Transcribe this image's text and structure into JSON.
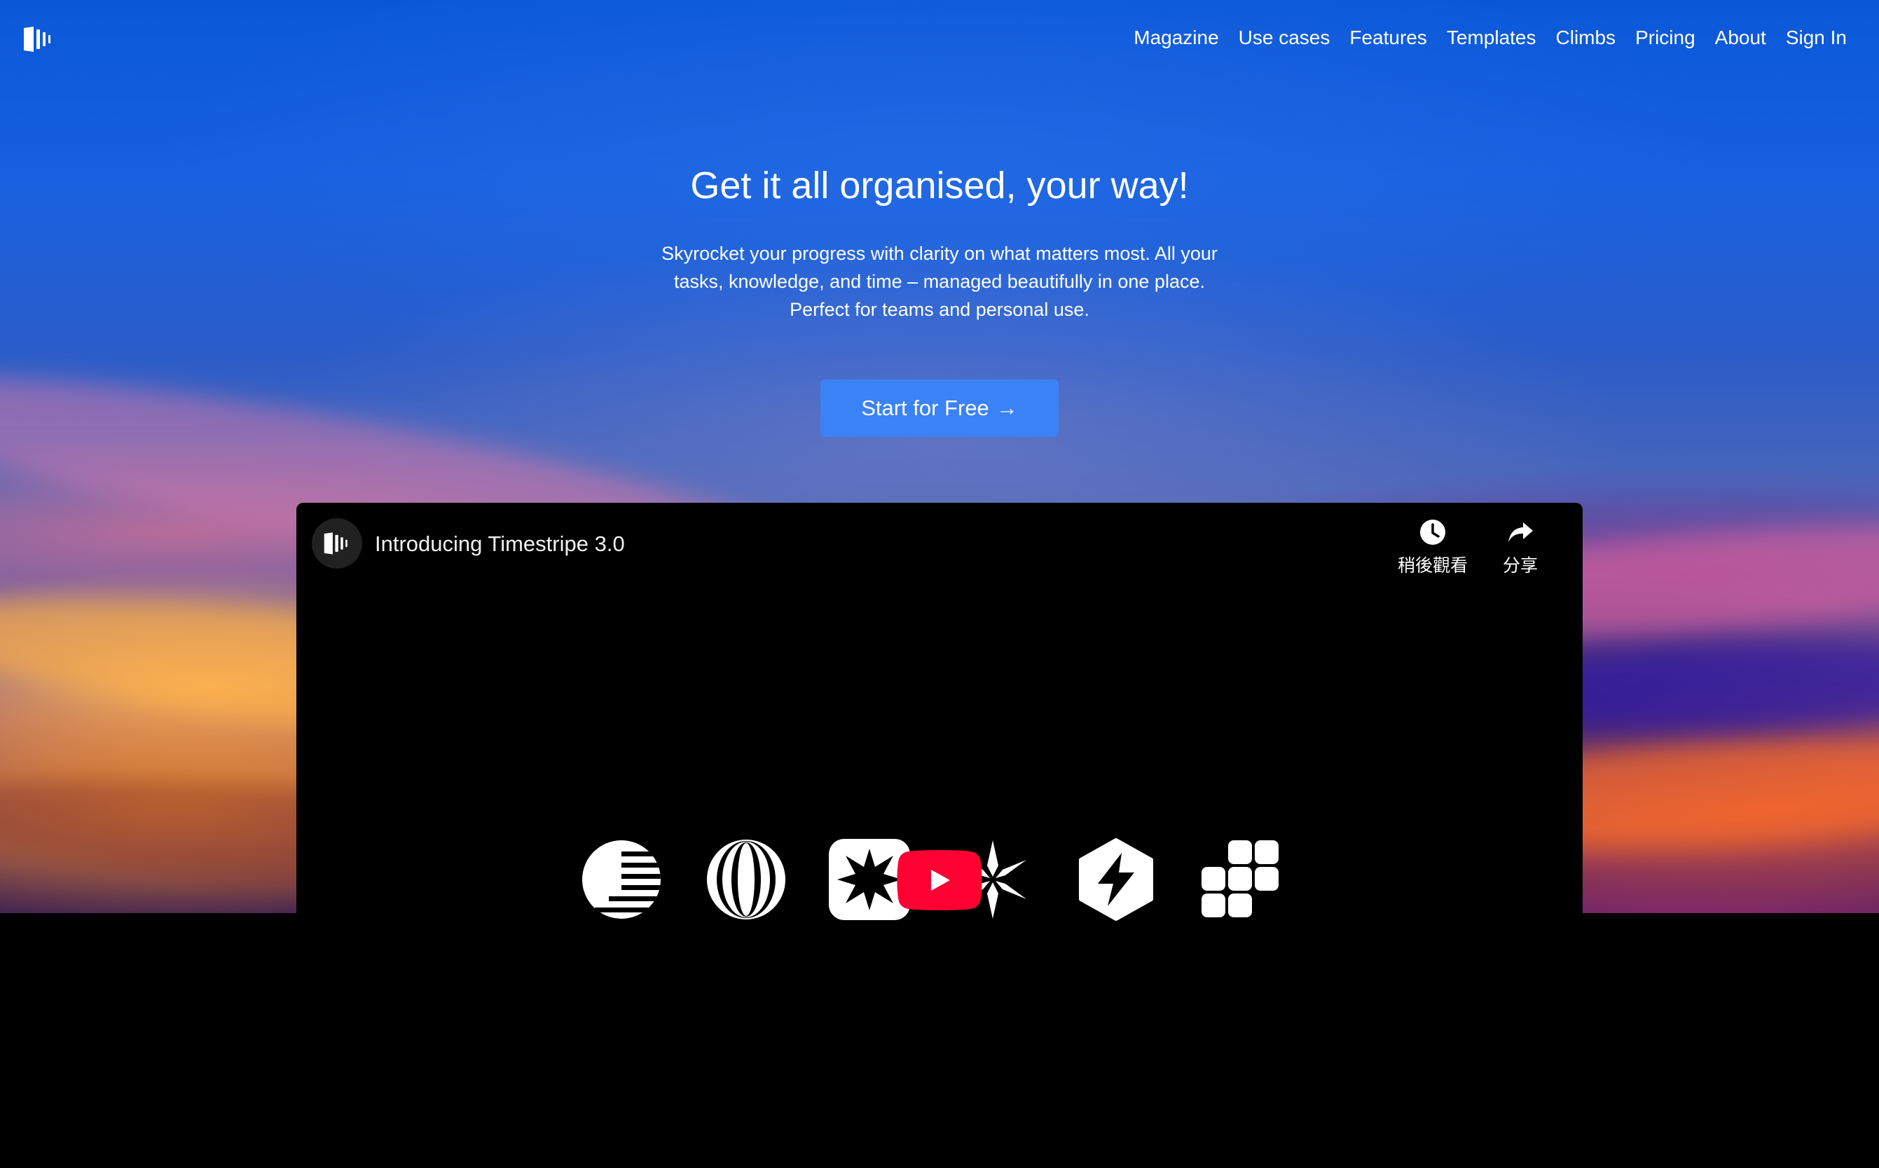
{
  "nav": {
    "items": [
      {
        "label": "Magazine"
      },
      {
        "label": "Use cases"
      },
      {
        "label": "Features"
      },
      {
        "label": "Templates"
      },
      {
        "label": "Climbs"
      },
      {
        "label": "Pricing"
      },
      {
        "label": "About"
      },
      {
        "label": "Sign In"
      }
    ]
  },
  "hero": {
    "headline": "Get it all organised, your way!",
    "subtext_lines": [
      "Skyrocket your progress with clarity on what matters most. All your",
      "tasks, knowledge, and time – managed beautifully in one place.",
      "Perfect for teams and personal use."
    ],
    "cta_label": "Start for Free",
    "cta_arrow": "→",
    "cta_color": "#3b82f6"
  },
  "video": {
    "title": "Introducing Timestripe 3.0",
    "watch_later_label": "稍後觀看",
    "share_label": "分享",
    "play_button_color": "#ff0033",
    "icons": [
      "sunrise-stripes-icon",
      "vertical-rings-icon",
      "starburst-box-icon",
      "snowflake-icon",
      "lightning-hexagon-icon",
      "grid-blocks-icon"
    ]
  }
}
